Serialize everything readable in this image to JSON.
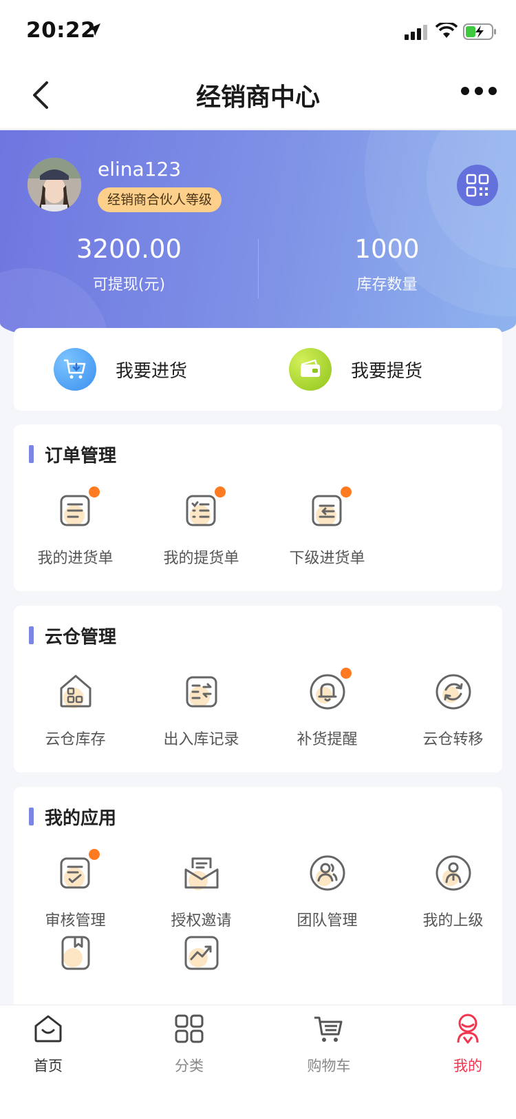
{
  "status": {
    "time": "20:22"
  },
  "nav": {
    "title": "经销商中心"
  },
  "profile": {
    "username": "elina123",
    "level": "经销商合伙人等级",
    "withdrawable_value": "3200.00",
    "withdrawable_label": "可提现(元)",
    "stock_value": "1000",
    "stock_label": "库存数量"
  },
  "quick_actions": [
    {
      "label": "我要进货",
      "icon": "cart-download-icon",
      "color": "#4aa3f5"
    },
    {
      "label": "我要提货",
      "icon": "wallet-icon",
      "color": "#a6d421"
    }
  ],
  "sections": {
    "orders": {
      "title": "订单管理",
      "items": [
        {
          "label": "我的进货单",
          "icon": "order-list-icon",
          "badge": true
        },
        {
          "label": "我的提货单",
          "icon": "checklist-icon",
          "badge": true
        },
        {
          "label": "下级进货单",
          "icon": "sub-order-icon",
          "badge": true
        }
      ]
    },
    "cloud": {
      "title": "云仓管理",
      "items": [
        {
          "label": "云仓库存",
          "icon": "warehouse-icon",
          "badge": false
        },
        {
          "label": "出入库记录",
          "icon": "transfer-record-icon",
          "badge": false
        },
        {
          "label": "补货提醒",
          "icon": "bell-icon",
          "badge": true
        },
        {
          "label": "云仓转移",
          "icon": "sync-icon",
          "badge": false
        }
      ]
    },
    "apps": {
      "title": "我的应用",
      "items": [
        {
          "label": "审核管理",
          "icon": "review-icon",
          "badge": true
        },
        {
          "label": "授权邀请",
          "icon": "invite-envelope-icon",
          "badge": false
        },
        {
          "label": "团队管理",
          "icon": "team-icon",
          "badge": false
        },
        {
          "label": "我的上级",
          "icon": "superior-icon",
          "badge": false
        },
        {
          "label": "",
          "icon": "bookmark-icon",
          "badge": false
        },
        {
          "label": "",
          "icon": "trend-chart-icon",
          "badge": false
        }
      ]
    }
  },
  "tabs": [
    {
      "label": "首页",
      "icon": "home-icon"
    },
    {
      "label": "分类",
      "icon": "category-icon"
    },
    {
      "label": "购物车",
      "icon": "cart-icon"
    },
    {
      "label": "我的",
      "icon": "profile-icon",
      "active": true
    }
  ],
  "colors": {
    "accent": "#7b86e4",
    "badge": "#ff7a20",
    "active_tab": "#f2364e",
    "icon_fill": "#fde6c4"
  }
}
